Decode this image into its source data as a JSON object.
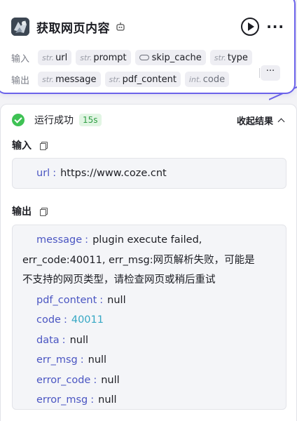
{
  "node": {
    "title": "获取网页内容",
    "icon": "app-thumbnail-icon",
    "inputs_label": "输入",
    "outputs_label": "输出",
    "inputs": [
      {
        "type": "str.",
        "name": "url"
      },
      {
        "type": "str.",
        "name": "prompt"
      },
      {
        "type": "toggle",
        "name": "skip_cache"
      },
      {
        "type": "str.",
        "name": "type"
      }
    ],
    "outputs": [
      {
        "type": "str.",
        "name": "message"
      },
      {
        "type": "str.",
        "name": "pdf_content"
      },
      {
        "type": "int.",
        "name": "code"
      }
    ],
    "more_outputs": "···"
  },
  "result": {
    "status": "运行成功",
    "duration": "15s",
    "collapse_label": "收起结果",
    "input_title": "输入",
    "output_title": "输出",
    "input": {
      "key": "url",
      "value": "https://www.coze.cnt"
    },
    "output": {
      "message_key": "message",
      "message_line1": "plugin execute failed,",
      "message_line2": "err_code:40011, err_msg:网页解析失败，可能是",
      "message_line3": "不支持的网页类型，请检查网页或稍后重试",
      "fields": [
        {
          "key": "pdf_content",
          "value": "null",
          "kind": "null"
        },
        {
          "key": "code",
          "value": "40011",
          "kind": "number"
        },
        {
          "key": "data",
          "value": "null",
          "kind": "null"
        },
        {
          "key": "err_msg",
          "value": "null",
          "kind": "null"
        },
        {
          "key": "error_code",
          "value": "null",
          "kind": "null"
        },
        {
          "key": "error_msg",
          "value": "null",
          "kind": "null"
        }
      ]
    },
    "separator": ":"
  },
  "colors": {
    "accent": "#6b62ea",
    "success": "#3ec254",
    "key": "#4a55c2",
    "number": "#35a7c4"
  }
}
